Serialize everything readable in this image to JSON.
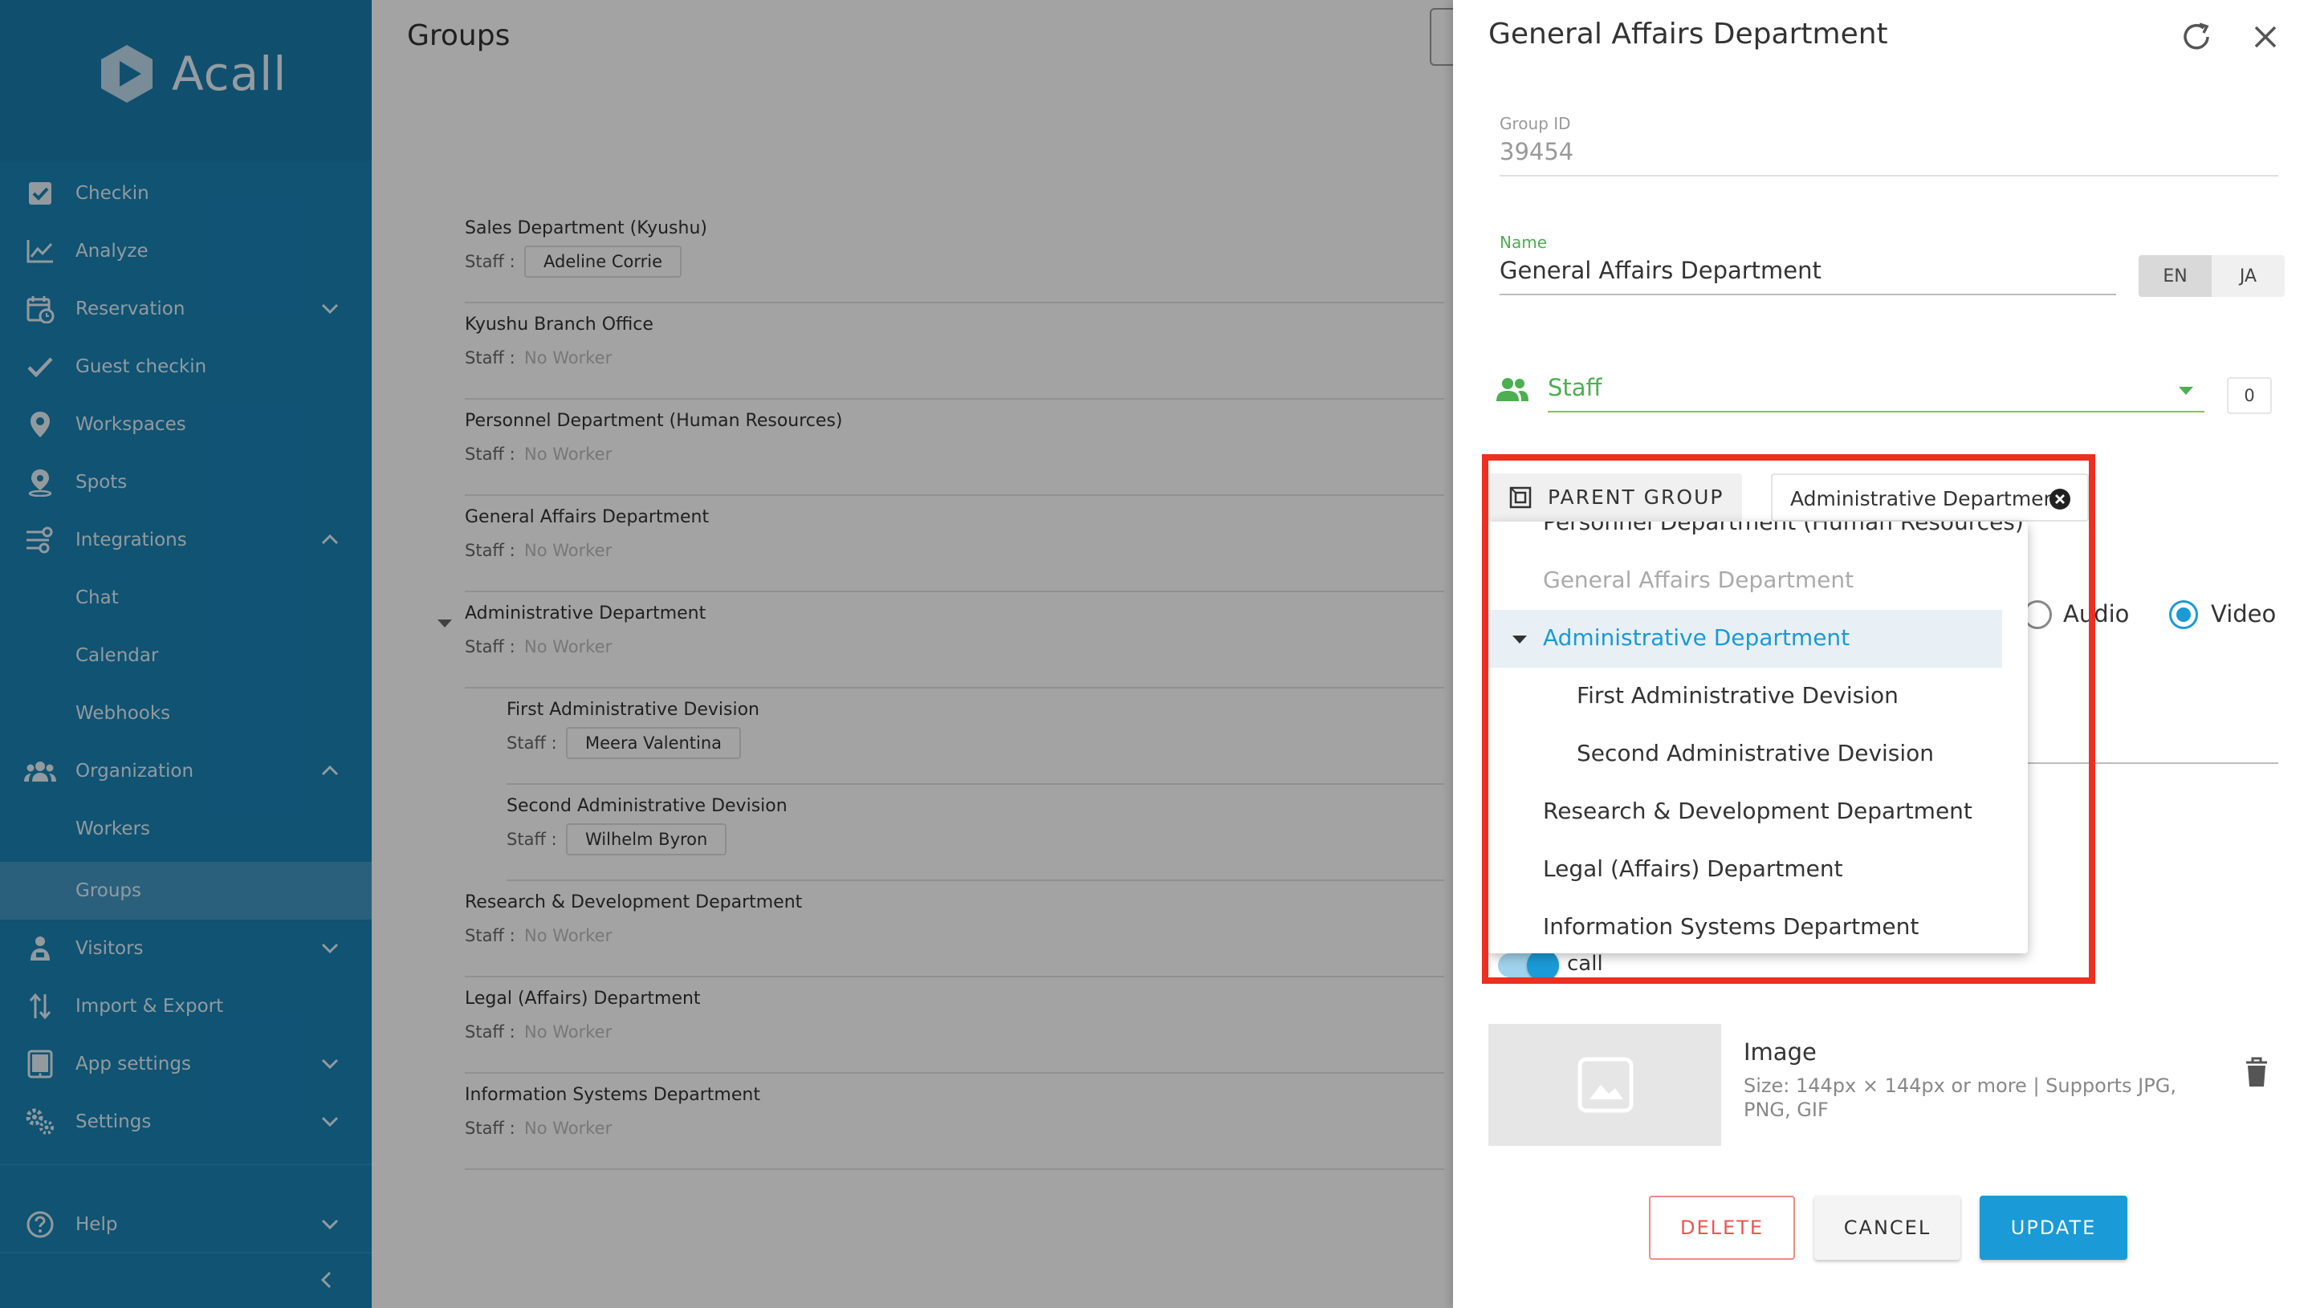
{
  "app": {
    "name": "Acall"
  },
  "sidebar": {
    "items": [
      {
        "label": "Checkin",
        "icon": "checkbox-icon"
      },
      {
        "label": "Analyze",
        "icon": "chart-line-icon"
      },
      {
        "label": "Reservation",
        "icon": "calendar-clock-icon",
        "chevron": "down"
      },
      {
        "label": "Guest checkin",
        "icon": "checkmark-icon"
      },
      {
        "label": "Workspaces",
        "icon": "map-pin-icon"
      },
      {
        "label": "Spots",
        "icon": "location-pin-icon"
      },
      {
        "label": "Integrations",
        "icon": "integrations-icon",
        "chevron": "up"
      },
      {
        "label": "Chat",
        "sub": true
      },
      {
        "label": "Calendar",
        "sub": true
      },
      {
        "label": "Webhooks",
        "sub": true
      },
      {
        "label": "Organization",
        "icon": "people-icon",
        "chevron": "up"
      },
      {
        "label": "Workers",
        "sub": true
      },
      {
        "label": "Groups",
        "sub": true,
        "active": true
      },
      {
        "label": "Visitors",
        "icon": "visitor-icon",
        "chevron": "down"
      },
      {
        "label": "Import & Export",
        "icon": "sort-arrows-icon"
      },
      {
        "label": "App settings",
        "icon": "tablet-icon",
        "chevron": "down"
      },
      {
        "label": "Settings",
        "icon": "gears-icon",
        "chevron": "down"
      },
      {
        "label": "Help",
        "icon": "help-icon",
        "chevron": "down"
      }
    ]
  },
  "main": {
    "title": "Groups",
    "staff_prefix": "Staff :",
    "no_worker": "No Worker",
    "groups": [
      {
        "name": "Sales Department (Kyushu)",
        "staff": "Adeline Corrie"
      },
      {
        "name": "Kyushu Branch Office",
        "staff": ""
      },
      {
        "name": "Personnel Department (Human Resources)",
        "staff": ""
      },
      {
        "name": "General Affairs Department",
        "staff": ""
      },
      {
        "name": "Administrative Department",
        "staff": "",
        "expanded": true
      },
      {
        "name": "First Administrative Devision",
        "staff": "Meera Valentina",
        "child": true
      },
      {
        "name": "Second Administrative Devision",
        "staff": "Wilhelm Byron",
        "child": true
      },
      {
        "name": "Research & Development Department",
        "staff": ""
      },
      {
        "name": "Legal (Affairs) Department",
        "staff": ""
      },
      {
        "name": "Information Systems Department",
        "staff": ""
      }
    ]
  },
  "panel": {
    "title": "General Affairs Department",
    "group_id_label": "Group ID",
    "group_id_value": "39454",
    "name_label": "Name",
    "name_value": "General Affairs Department",
    "lang": {
      "en": "EN",
      "ja": "JA",
      "selected": "EN"
    },
    "staff_label": "Staff",
    "staff_count": "0",
    "parent_group_label": "PARENT GROUP",
    "parent_group_value": "Administrative Department",
    "radio_audio": "Audio",
    "radio_video": "Video",
    "radio_selected": "Video",
    "toggle_label": "call",
    "image_title": "Image",
    "image_desc": "Size: 144px × 144px or more | Supports JPG, PNG, GIF",
    "buttons": {
      "delete": "DELETE",
      "cancel": "CANCEL",
      "update": "UPDATE"
    }
  },
  "dropdown": {
    "items": [
      {
        "label": "Personnel Department (Human Resources)",
        "state": "partial"
      },
      {
        "label": "General Affairs Department",
        "state": "disabled"
      },
      {
        "label": "Administrative Department",
        "state": "selected"
      },
      {
        "label": "First Administrative Devision",
        "state": "child"
      },
      {
        "label": "Second Administrative Devision",
        "state": "child"
      },
      {
        "label": "Research & Development Department",
        "state": "normal"
      },
      {
        "label": "Legal (Affairs) Department",
        "state": "normal"
      },
      {
        "label": "Information Systems Department",
        "state": "normal"
      }
    ]
  },
  "colors": {
    "sidebar": "#1a82b5",
    "accent": "#1a9ad6",
    "green": "#4caf50",
    "danger": "#ef5350",
    "highlight": "#ee2e1f"
  }
}
